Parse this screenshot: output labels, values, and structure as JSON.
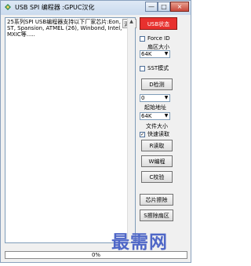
{
  "window": {
    "title": "USB SPI 编程器 :GPUC汉化",
    "controls": [
      "—",
      "□",
      "×"
    ]
  },
  "log": {
    "text": "25系列SPI USB编程器支持以下厂家芯片:Eon, ST, Spansion, ATMEL (26), Winbond, Intel,MXIC等.....",
    "clear_label": "清除"
  },
  "side": {
    "usb_status": "USB状态",
    "force_id": "Force ID",
    "sector_size_label": "扇区大小",
    "sector_size_value": "64K",
    "sst_mode": "SST模式",
    "detect_button": "D检测",
    "start_address_value": "0",
    "start_address_label": "起始地址",
    "file_size_value": "64K",
    "file_size_label": "文件大小",
    "fast_read_label": "快速读取",
    "read_button": "R读取",
    "write_button": "W编程",
    "verify_button": "C校验",
    "chip_erase_button": "芯片擦除",
    "sector_erase_button": "S擦除扇区"
  },
  "status": {
    "progress": "0%"
  },
  "watermark": {
    "text": "最需网"
  }
}
